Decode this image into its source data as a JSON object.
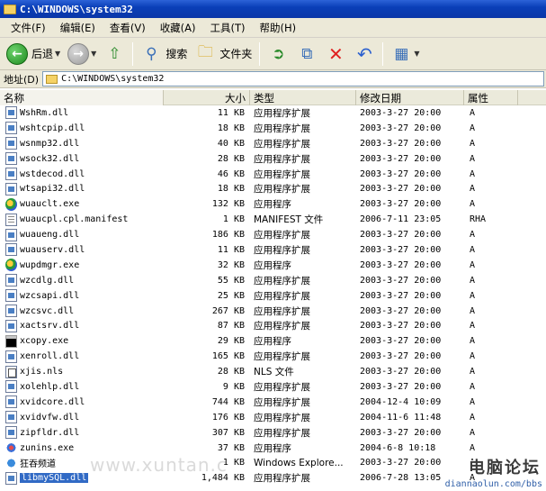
{
  "window": {
    "title": "C:\\WINDOWS\\system32"
  },
  "menu": [
    "文件(F)",
    "编辑(E)",
    "查看(V)",
    "收藏(A)",
    "工具(T)",
    "帮助(H)"
  ],
  "toolbar": {
    "back_label": "后退",
    "search_label": "搜索",
    "folders_label": "文件夹"
  },
  "address": {
    "label": "地址(D)",
    "value": "C:\\WINDOWS\\system32"
  },
  "columns": {
    "name": "名称",
    "size": "大小",
    "type": "类型",
    "modified": "修改日期",
    "attr": "属性"
  },
  "files": [
    {
      "name": "WshRm.dll",
      "size": "11 KB",
      "type": "应用程序扩展",
      "modified": "2003-3-27 20:00",
      "attr": "A",
      "icon": "dll"
    },
    {
      "name": "wshtcpip.dll",
      "size": "18 KB",
      "type": "应用程序扩展",
      "modified": "2003-3-27 20:00",
      "attr": "A",
      "icon": "dll"
    },
    {
      "name": "wsnmp32.dll",
      "size": "40 KB",
      "type": "应用程序扩展",
      "modified": "2003-3-27 20:00",
      "attr": "A",
      "icon": "dll"
    },
    {
      "name": "wsock32.dll",
      "size": "28 KB",
      "type": "应用程序扩展",
      "modified": "2003-3-27 20:00",
      "attr": "A",
      "icon": "dll"
    },
    {
      "name": "wstdecod.dll",
      "size": "46 KB",
      "type": "应用程序扩展",
      "modified": "2003-3-27 20:00",
      "attr": "A",
      "icon": "dll"
    },
    {
      "name": "wtsapi32.dll",
      "size": "18 KB",
      "type": "应用程序扩展",
      "modified": "2003-3-27 20:00",
      "attr": "A",
      "icon": "dll"
    },
    {
      "name": "wuauclt.exe",
      "size": "132 KB",
      "type": "应用程序",
      "modified": "2003-3-27 20:00",
      "attr": "A",
      "icon": "exe"
    },
    {
      "name": "wuaucpl.cpl.manifest",
      "size": "1 KB",
      "type": "MANIFEST 文件",
      "modified": "2006-7-11 23:05",
      "attr": "RHA",
      "icon": "manifest"
    },
    {
      "name": "wuaueng.dll",
      "size": "186 KB",
      "type": "应用程序扩展",
      "modified": "2003-3-27 20:00",
      "attr": "A",
      "icon": "dll"
    },
    {
      "name": "wuauserv.dll",
      "size": "11 KB",
      "type": "应用程序扩展",
      "modified": "2003-3-27 20:00",
      "attr": "A",
      "icon": "dll"
    },
    {
      "name": "wupdmgr.exe",
      "size": "32 KB",
      "type": "应用程序",
      "modified": "2003-3-27 20:00",
      "attr": "A",
      "icon": "exe"
    },
    {
      "name": "wzcdlg.dll",
      "size": "55 KB",
      "type": "应用程序扩展",
      "modified": "2003-3-27 20:00",
      "attr": "A",
      "icon": "dll"
    },
    {
      "name": "wzcsapi.dll",
      "size": "25 KB",
      "type": "应用程序扩展",
      "modified": "2003-3-27 20:00",
      "attr": "A",
      "icon": "dll"
    },
    {
      "name": "wzcsvc.dll",
      "size": "267 KB",
      "type": "应用程序扩展",
      "modified": "2003-3-27 20:00",
      "attr": "A",
      "icon": "dll"
    },
    {
      "name": "xactsrv.dll",
      "size": "87 KB",
      "type": "应用程序扩展",
      "modified": "2003-3-27 20:00",
      "attr": "A",
      "icon": "dll"
    },
    {
      "name": "xcopy.exe",
      "size": "29 KB",
      "type": "应用程序",
      "modified": "2003-3-27 20:00",
      "attr": "A",
      "icon": "xcopy"
    },
    {
      "name": "xenroll.dll",
      "size": "165 KB",
      "type": "应用程序扩展",
      "modified": "2003-3-27 20:00",
      "attr": "A",
      "icon": "dll"
    },
    {
      "name": "xjis.nls",
      "size": "28 KB",
      "type": "NLS 文件",
      "modified": "2003-3-27 20:00",
      "attr": "A",
      "icon": "nls"
    },
    {
      "name": "xolehlp.dll",
      "size": "9 KB",
      "type": "应用程序扩展",
      "modified": "2003-3-27 20:00",
      "attr": "A",
      "icon": "dll"
    },
    {
      "name": "xvidcore.dll",
      "size": "744 KB",
      "type": "应用程序扩展",
      "modified": "2004-12-4 10:09",
      "attr": "A",
      "icon": "dll"
    },
    {
      "name": "xvidvfw.dll",
      "size": "176 KB",
      "type": "应用程序扩展",
      "modified": "2004-11-6 11:48",
      "attr": "A",
      "icon": "dll"
    },
    {
      "name": "zipfldr.dll",
      "size": "307 KB",
      "type": "应用程序扩展",
      "modified": "2003-3-27 20:00",
      "attr": "A",
      "icon": "dll"
    },
    {
      "name": "zunins.exe",
      "size": "37 KB",
      "type": "应用程序",
      "modified": "2004-6-8 10:18",
      "attr": "A",
      "icon": "zunins"
    },
    {
      "name": "狂吞频道",
      "size": "1 KB",
      "type": "Windows Explore...",
      "modified": "2003-3-27 20:00",
      "attr": "A",
      "icon": "url"
    },
    {
      "name": "libmySQL.dll",
      "size": "1,484 KB",
      "type": "应用程序扩展",
      "modified": "2006-7-28 13:05",
      "attr": "A",
      "icon": "dll",
      "selected": true
    }
  ],
  "watermark": {
    "text": "www.xuntan.c",
    "logo": "电脑论坛",
    "url": "diannaolun.com/bbs"
  }
}
